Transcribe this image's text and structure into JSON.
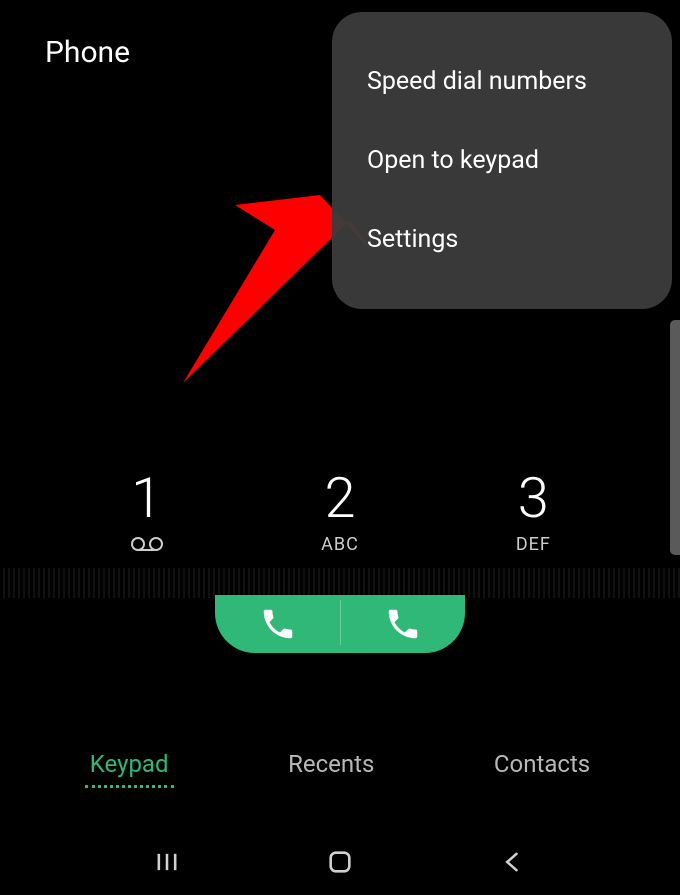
{
  "header": {
    "title": "Phone"
  },
  "menu": {
    "items": [
      {
        "label": "Speed dial numbers"
      },
      {
        "label": "Open to keypad"
      },
      {
        "label": "Settings"
      }
    ]
  },
  "keypad": {
    "keys": [
      {
        "number": "1",
        "letters": ""
      },
      {
        "number": "2",
        "letters": "ABC"
      },
      {
        "number": "3",
        "letters": "DEF"
      }
    ]
  },
  "tabs": {
    "items": [
      {
        "label": "Keypad",
        "active": true
      },
      {
        "label": "Recents",
        "active": false
      },
      {
        "label": "Contacts",
        "active": false
      }
    ]
  },
  "colors": {
    "accent": "#2fb877",
    "background": "#000000",
    "menu_bg": "#3c3c3c"
  }
}
